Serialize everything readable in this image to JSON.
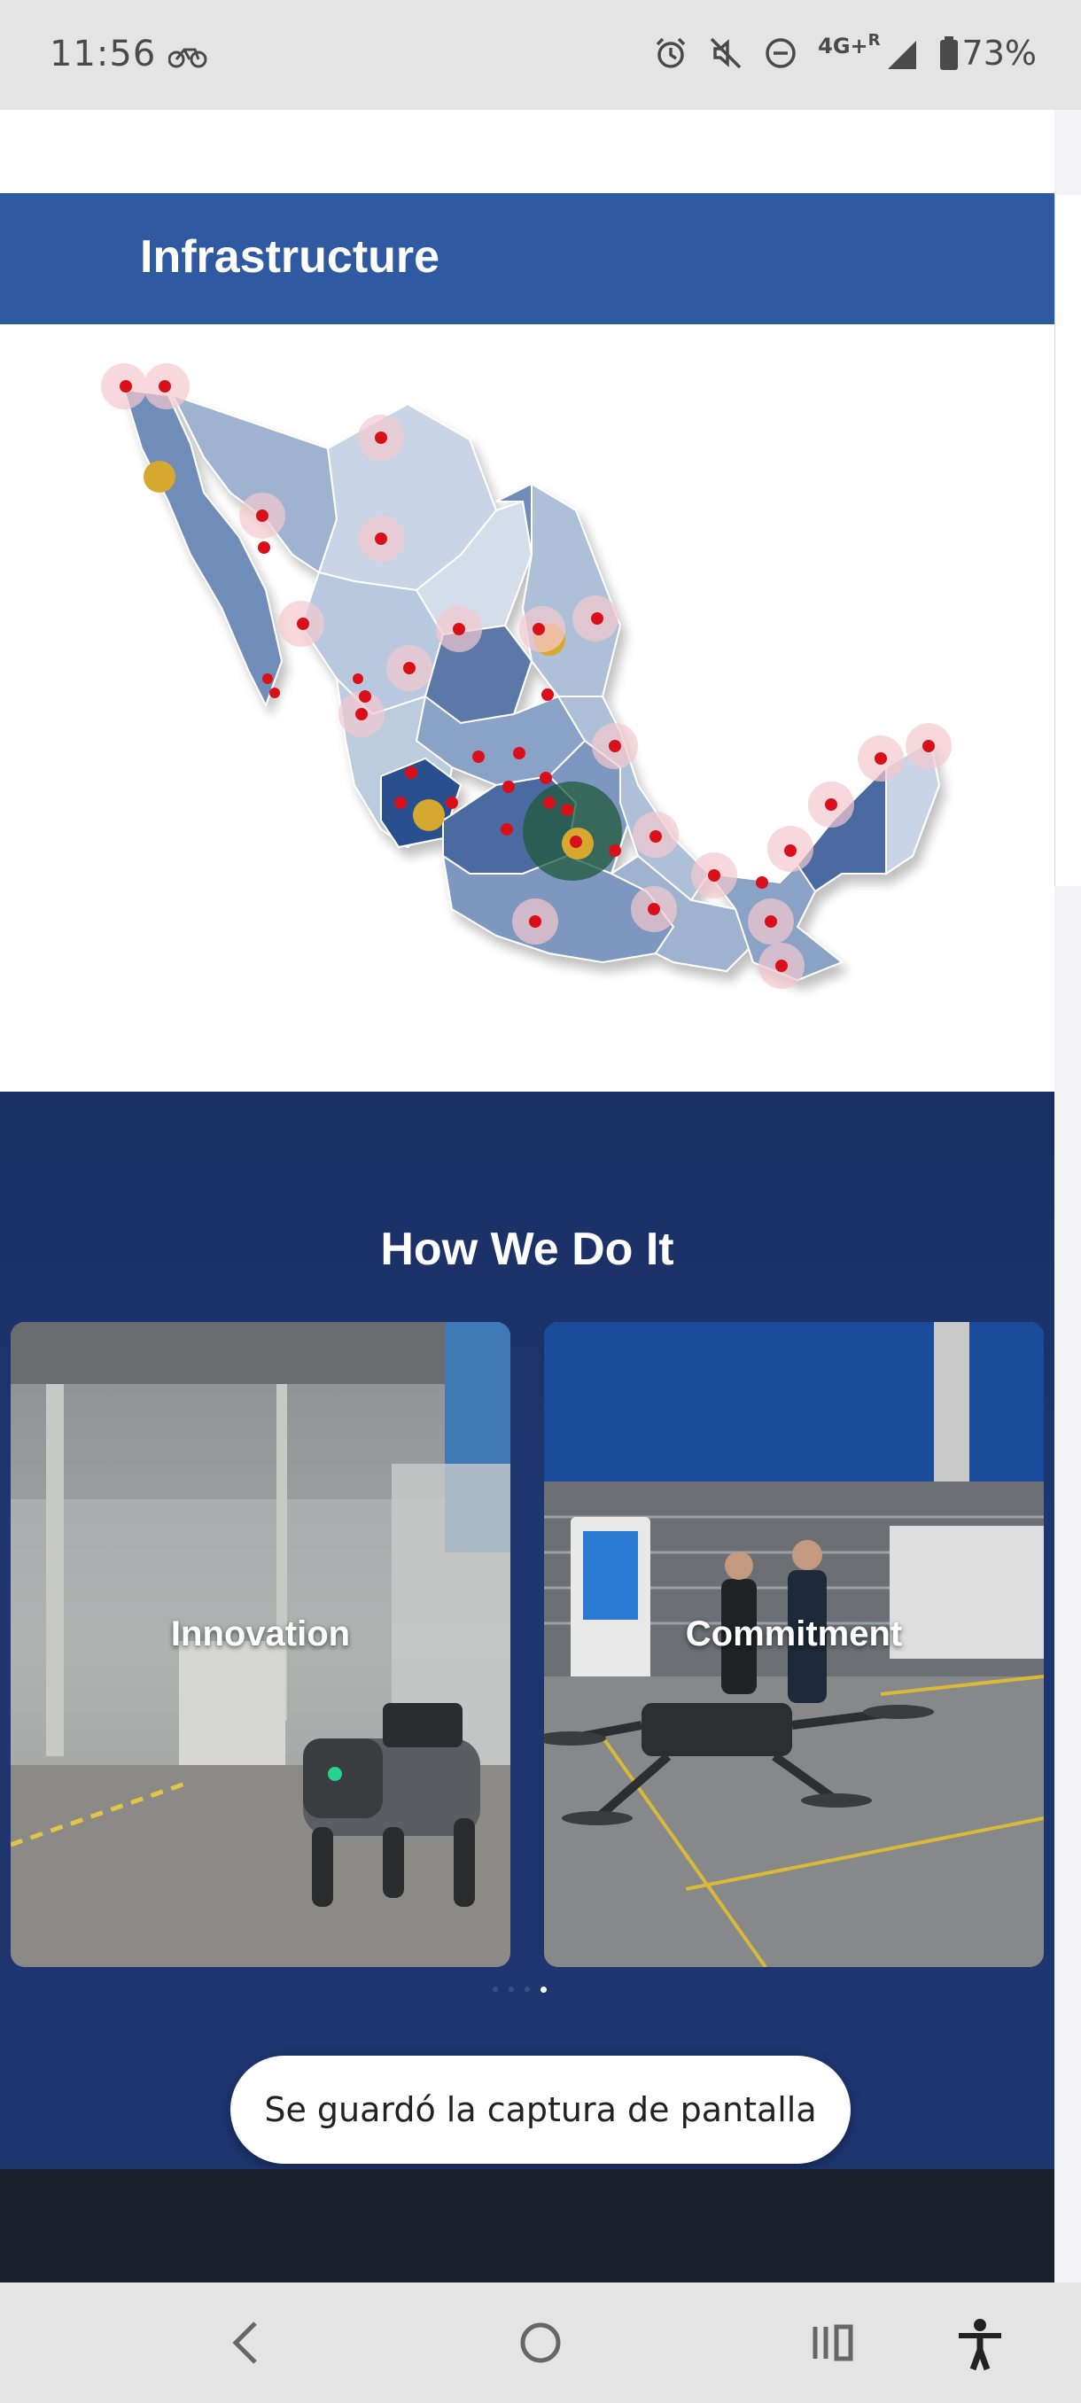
{
  "status_bar": {
    "time": "11:56",
    "network": "4G+",
    "roaming": "R",
    "battery": "73%"
  },
  "infrastructure": {
    "title": "Infrastructure"
  },
  "how_we_do_it": {
    "title": "How We Do It",
    "cards": [
      {
        "label": "Innovation"
      },
      {
        "label": "Commitment"
      }
    ],
    "carousel_pages": 4,
    "active_page": 4
  },
  "toast": {
    "message": "Se guardó la captura de pantalla"
  },
  "colors": {
    "header_blue": "#2f59a0",
    "section_navy": "#1e3570",
    "marker_red": "#d9101a",
    "marker_gold": "#d6a92e"
  }
}
